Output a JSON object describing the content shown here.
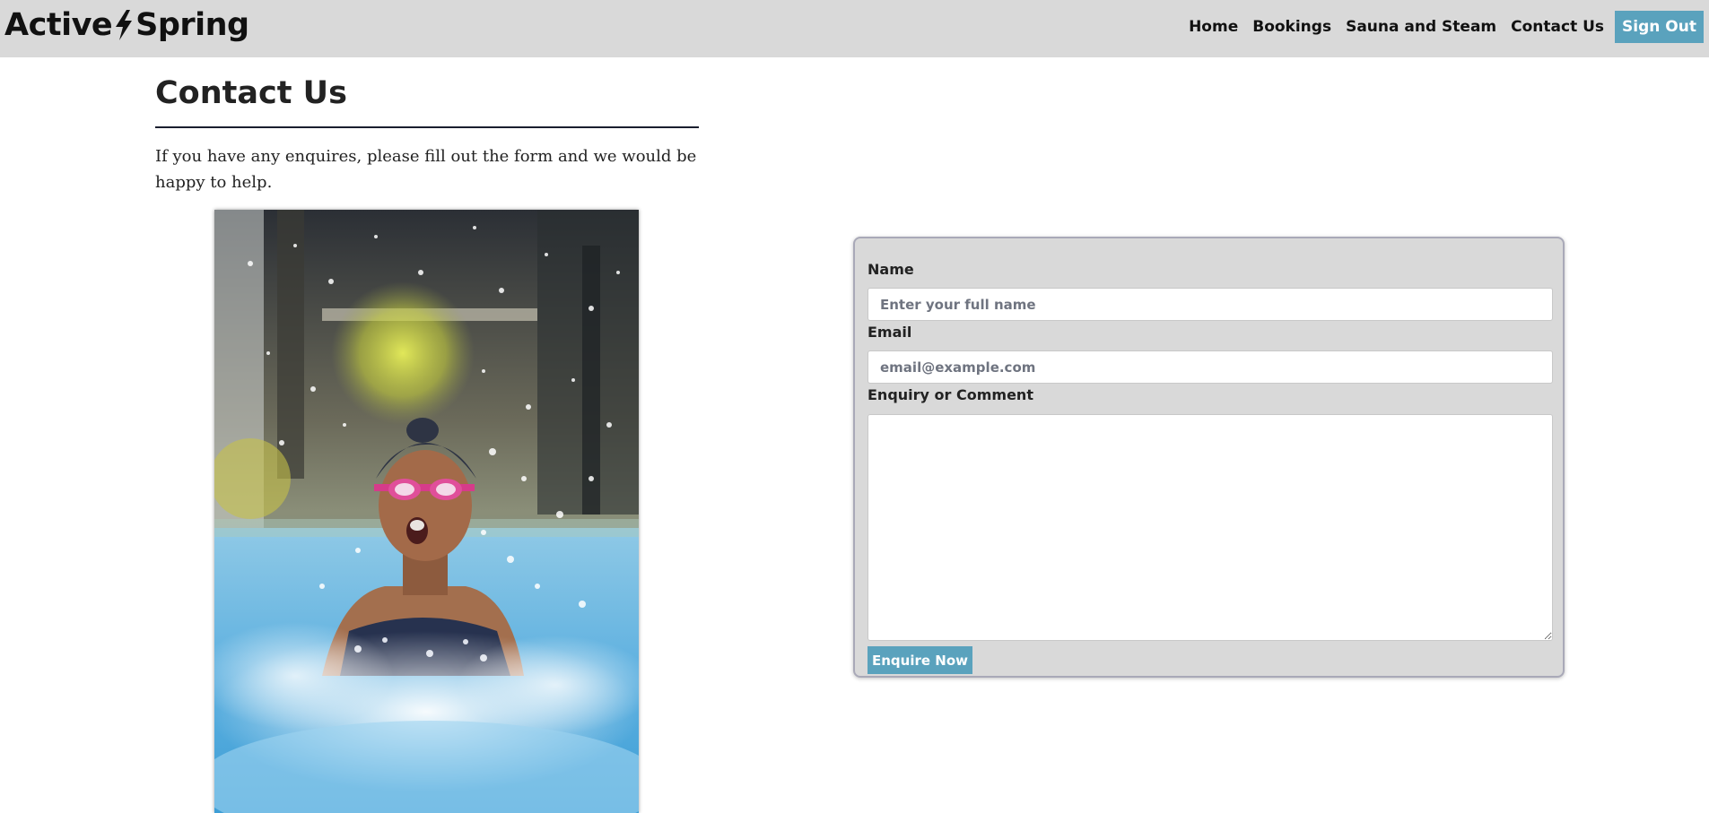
{
  "brand": {
    "part1": "Active",
    "part2": "Spring",
    "logo_icon": "lightning-bolt-icon"
  },
  "nav": {
    "items": [
      {
        "label": "Home"
      },
      {
        "label": "Bookings"
      },
      {
        "label": "Sauna and Steam"
      },
      {
        "label": "Contact Us"
      }
    ],
    "sign_out_label": "Sign Out"
  },
  "page": {
    "title": "Contact Us",
    "intro": "If you have any enquires, please fill out the form and we would be happy to help."
  },
  "form": {
    "name_label": "Name",
    "name_placeholder": "Enter your full name",
    "name_value": "",
    "email_label": "Email",
    "email_placeholder": "email@example.com",
    "email_value": "",
    "comment_label": "Enquiry or Comment",
    "comment_value": "",
    "submit_label": "Enquire Now"
  },
  "colors": {
    "navbar_bg": "#d9d9d9",
    "accent": "#5aa2bd",
    "form_bg": "#d9d9d9",
    "text": "#222222"
  }
}
